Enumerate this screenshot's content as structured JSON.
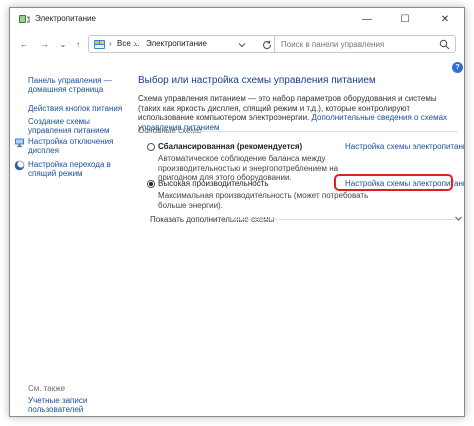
{
  "window": {
    "title": "Электропитание",
    "controls": {
      "minimize": "—",
      "maximize": "☐",
      "close": "✕"
    }
  },
  "navigation": {
    "back": "←",
    "forward": "→",
    "recent": "⌄",
    "up": "↑",
    "breadcrumb": [
      "Все ...",
      "Электропитание"
    ],
    "breadcrumb_separator": "›"
  },
  "search": {
    "placeholder": "Поиск в панели управления"
  },
  "sidebar": {
    "items": [
      {
        "label": "Панель управления — домашняя страница",
        "icon": ""
      },
      {
        "label": "Действия кнопок питания",
        "icon": ""
      },
      {
        "label": "Создание схемы управления питанием",
        "icon": ""
      },
      {
        "label": "Настройка отключения дисплея",
        "icon": "monitor-icon"
      },
      {
        "label": "Настройка перехода в спящий режим",
        "icon": "moon-icon"
      }
    ],
    "see_also": "См. также",
    "see_also_items": [
      {
        "label": "Учетные записи пользователей"
      }
    ]
  },
  "main": {
    "title": "Выбор или настройка схемы управления питанием",
    "description": "Схема управления питанием — это набор параметров оборудования и системы (таких как яркость дисплея, спящий режим и т.д.), которые контролируют использование компьютером электроэнергии.",
    "description_link": "Дополнительные сведения о схемах управления питанием",
    "section_label": "Основные схемы",
    "plans": [
      {
        "name": "Сбалансированная (рекомендуется)",
        "selected": false,
        "description": "Автоматическое соблюдение баланса между производительностью и энергопотреблением на пригодном для этого оборудовании.",
        "settings_link": "Настройка схемы электропитания"
      },
      {
        "name": "Высокая производительность",
        "selected": true,
        "description": "Максимальная производительность (может потребовать больше энергии).",
        "settings_link": "Настройка схемы электропитания"
      }
    ],
    "more_plans": "Показать дополнительные схемы",
    "help": "?"
  },
  "colors": {
    "link": "#1a4f9c",
    "title": "#1a3d8f",
    "highlight": "#e02020"
  }
}
